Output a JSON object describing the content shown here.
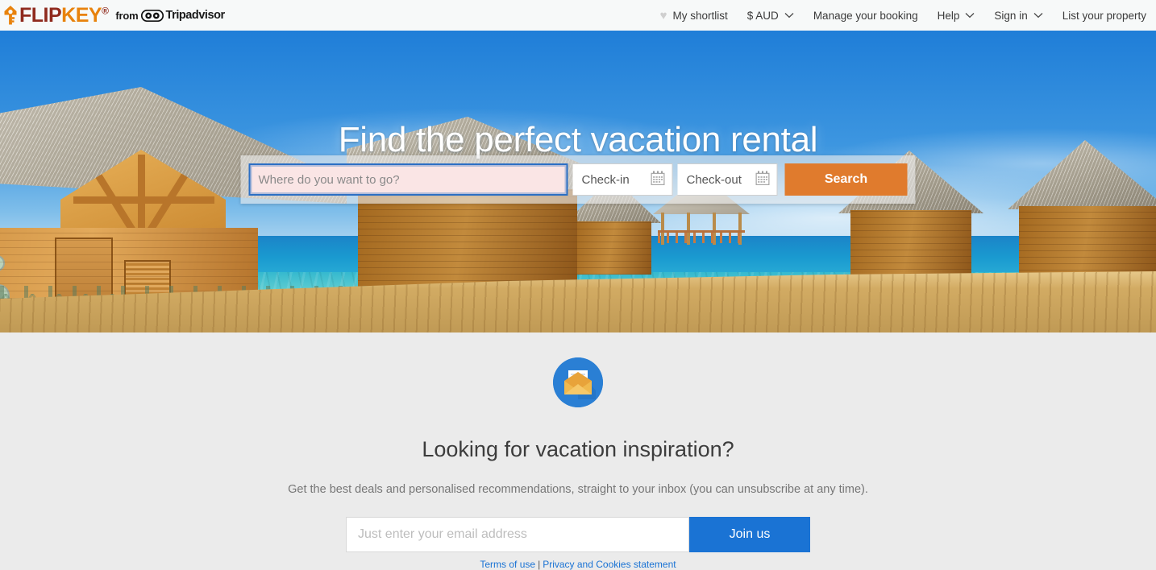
{
  "header": {
    "logo": {
      "icon": "house-key-icon",
      "flip": "FLIP",
      "key": "KEY",
      "trademark": "®",
      "from": "from",
      "owl_icon": "tripadvisor-owl-icon",
      "tripadvisor": "Tripadvisor"
    },
    "nav": [
      {
        "label": "My shortlist",
        "icon": "heart-icon",
        "chevron": false
      },
      {
        "label": "$ AUD",
        "icon": null,
        "chevron": true
      },
      {
        "label": "Manage your booking",
        "icon": null,
        "chevron": false
      },
      {
        "label": "Help",
        "icon": null,
        "chevron": true
      },
      {
        "label": "Sign in",
        "icon": null,
        "chevron": true
      },
      {
        "label": "List your property",
        "icon": null,
        "chevron": false
      }
    ]
  },
  "hero": {
    "title": "Find the perfect vacation rental",
    "image_description": "Overwater thatched-roof bungalows on a tropical lagoon with a wooden boardwalk and gazebo under a blue sky",
    "search": {
      "destination_placeholder": "Where do you want to go?",
      "destination_value": "",
      "checkin_label": "Check-in",
      "checkout_label": "Check-out",
      "calendar_icon": "calendar-icon",
      "search_label": "Search"
    }
  },
  "newsletter": {
    "badge_icon": "open-envelope-icon",
    "title": "Looking for vacation inspiration?",
    "subtitle": "Get the best deals and personalised recommendations, straight to your inbox (you can unsubscribe at any time).",
    "email_placeholder": "Just enter your email address",
    "email_value": "",
    "join_label": "Join us",
    "terms_label": "Terms of use",
    "separator": "|",
    "privacy_label": "Privacy and Cookies statement"
  },
  "colors": {
    "logo_flip": "#8f2a1e",
    "logo_key": "#e8820c",
    "search_button": "#e07b2d",
    "join_button": "#1a73d4",
    "link": "#1a73d4",
    "focus_ring": "#2c6fc4",
    "error_field_bg": "#fae5e5",
    "page_bg": "#ebebeb",
    "header_bg": "#f7f9f9"
  }
}
